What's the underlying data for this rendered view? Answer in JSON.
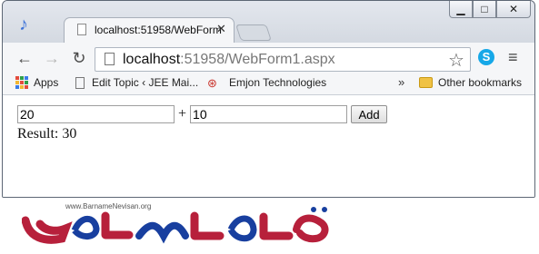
{
  "window": {
    "controls": [
      "▁",
      "□",
      "✕"
    ]
  },
  "tab": {
    "title": "localhost:51958/WebForm",
    "close": "✕"
  },
  "address_bar": {
    "host": "localhost",
    "rest": ":51958/WebForm1.aspx"
  },
  "toolbar": {
    "back": "←",
    "forward": "→",
    "reload": "↻",
    "star": "☆",
    "skype": "S",
    "menu": "≡"
  },
  "bookmarks": {
    "items": [
      "Apps",
      "Edit Topic ‹ JEE Mai...",
      "Emjon Technologies"
    ],
    "overflow": "»",
    "other": "Other bookmarks"
  },
  "form": {
    "first_value": "20",
    "operator": "+",
    "second_value": "10",
    "add_label": "Add",
    "result": "Result: 30"
  },
  "watermark": {
    "url": "www.BarnameNevisan.org",
    "logo_text": "برنامه نویسان"
  },
  "colors": {
    "accent": "#16a8e8",
    "logo": "#b7203b",
    "logo_blue": "#183f9f"
  }
}
